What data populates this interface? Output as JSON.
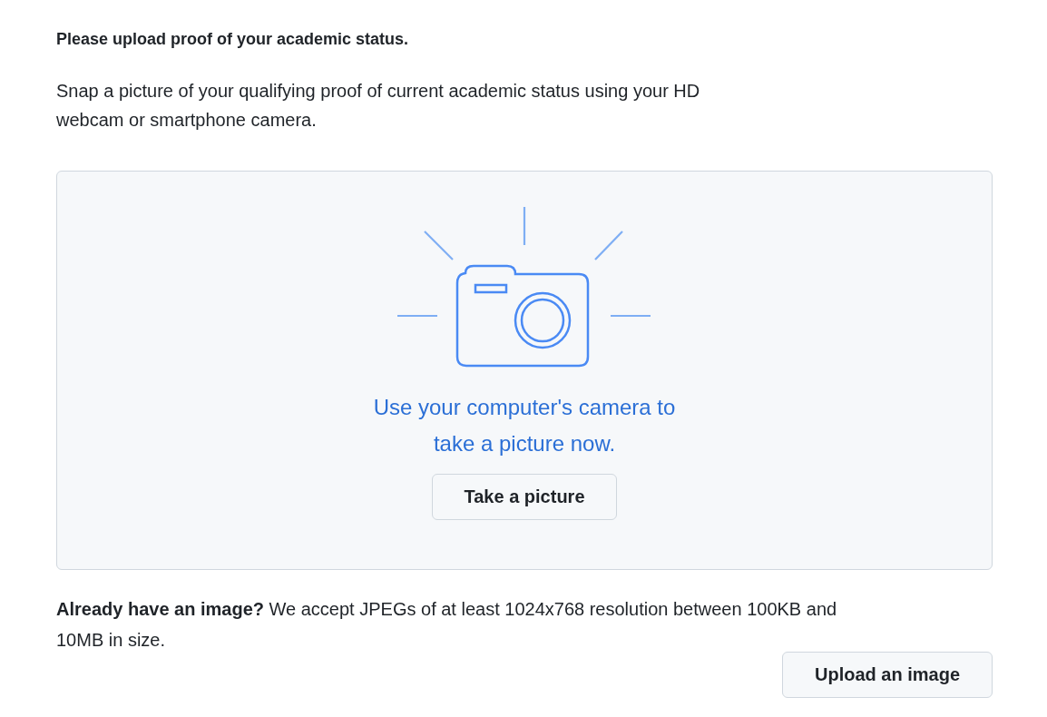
{
  "heading": "Please upload proof of your academic status.",
  "instructions": "Snap a picture of your qualifying proof of current academic status using your HD webcam or smartphone camera.",
  "camera_panel": {
    "prompt": "Use your computer's camera to take a picture now.",
    "button": "Take a picture"
  },
  "upload": {
    "text": "**Already have an image?** We accept JPEGs of at least 1024x768 resolution between 100KB and 10MB in size.",
    "button": "Upload an image"
  }
}
